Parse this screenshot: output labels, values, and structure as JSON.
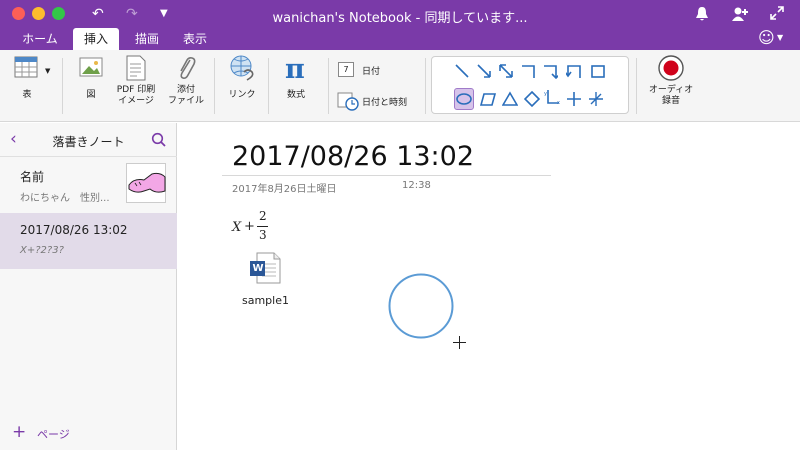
{
  "window": {
    "title": "wanichan's Notebook - 同期しています..."
  },
  "tabs": [
    {
      "label": "ホーム"
    },
    {
      "label": "挿入"
    },
    {
      "label": "描画"
    },
    {
      "label": "表示"
    }
  ],
  "ribbon": {
    "table": "表",
    "picture": "図",
    "pdf_line1": "PDF 印刷",
    "pdf_line2": "イメージ",
    "attach_line1": "添付",
    "attach_line2": "ファイル",
    "link": "リンク",
    "equation": "数式",
    "date": "日付",
    "date_icon_num": "7",
    "datetime": "日付と時刻",
    "audio_line1": "オーディオ",
    "audio_line2": "録音"
  },
  "sidebar": {
    "section_title": "落書きノート",
    "pages": [
      {
        "title": "名前",
        "preview": "わにちゃん　性別..."
      },
      {
        "title": "2017/08/26 13:02",
        "preview": "X+?2?3?"
      }
    ],
    "add_page": "ページ"
  },
  "page": {
    "title": "2017/08/26 13:02",
    "date": "2017年8月26日土曜日",
    "time": "12:38",
    "equation_x": "X",
    "equation_plus": "+",
    "equation_num": "2",
    "equation_den": "3",
    "attachment_name": "sample1",
    "attachment_badge": "W"
  },
  "colors": {
    "accent": "#7a3aa8",
    "selected_page": "#e2dbe9",
    "circle_stroke": "#5b9bd5"
  }
}
